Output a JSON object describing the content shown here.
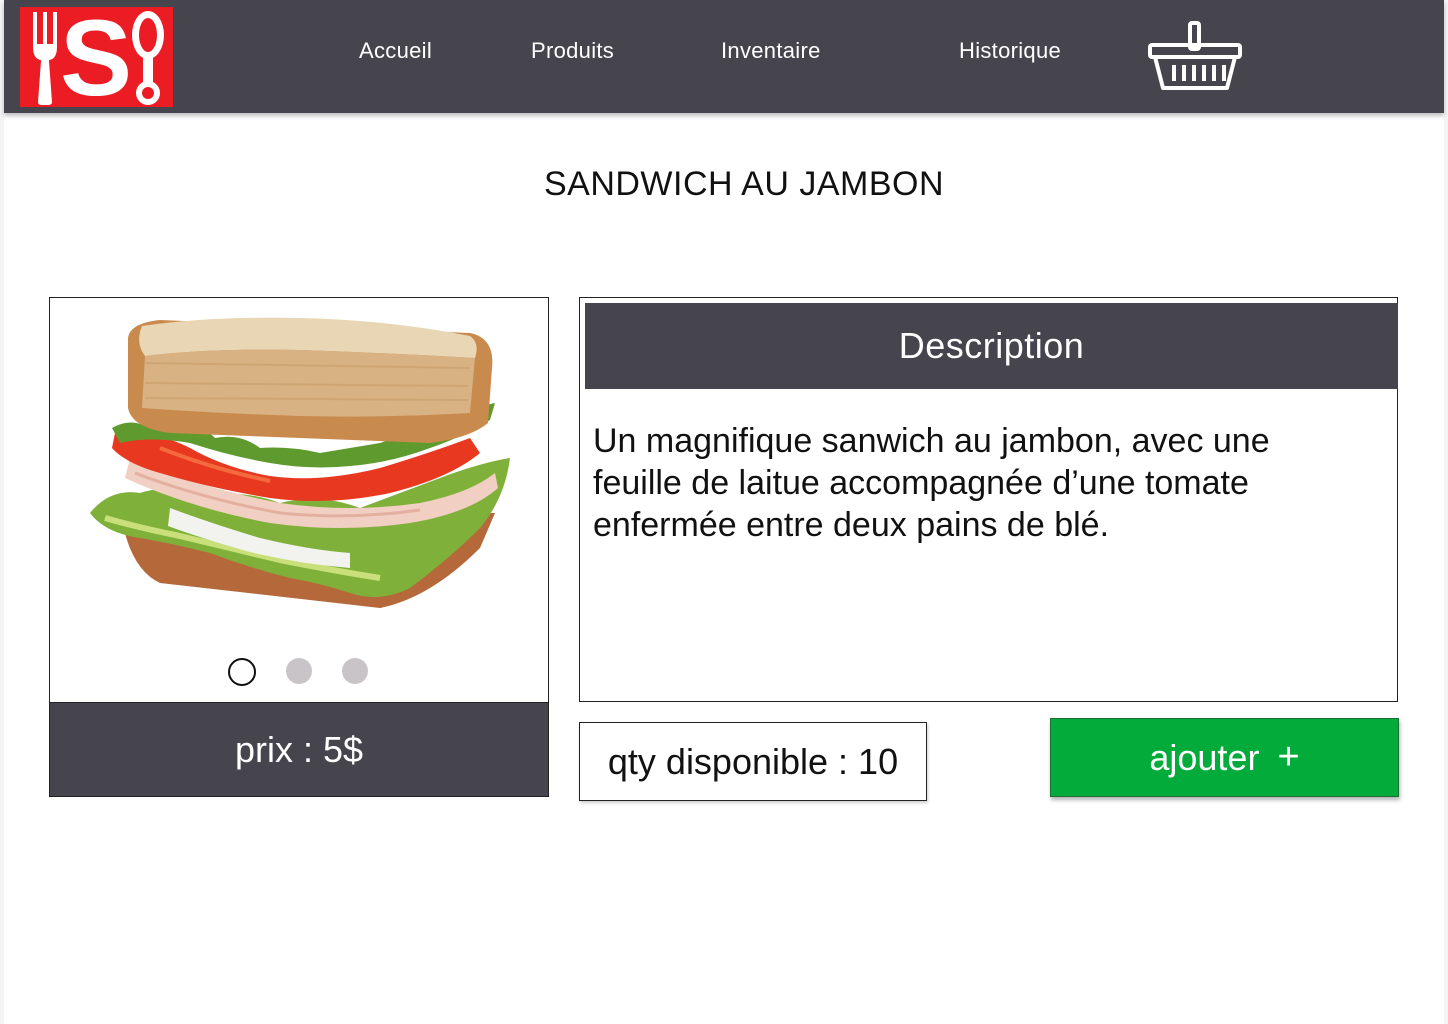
{
  "nav": {
    "links": [
      "Accueil",
      "Produits",
      "Inventaire",
      "Historique"
    ],
    "logo_letter": "S"
  },
  "product": {
    "title": "SANDWICH AU JAMBON",
    "price": "prix : 5$",
    "description_header": "Description",
    "description": "Un magnifique sanwich au jambon, avec une feuille de laitue accompagnée d’une tomate enfermée entre deux pains de blé.",
    "qty": "qty disponible : 10",
    "add_label": "ajouter",
    "add_symbol": "+"
  },
  "carousel": {
    "count": 3,
    "active_index": 0
  },
  "colors": {
    "navbar": "#46444d",
    "logo": "#ec1c24",
    "add_button": "#03ab3a"
  },
  "icons": {
    "logo": "fork-s-spoon-logo",
    "cart": "basket-icon"
  }
}
